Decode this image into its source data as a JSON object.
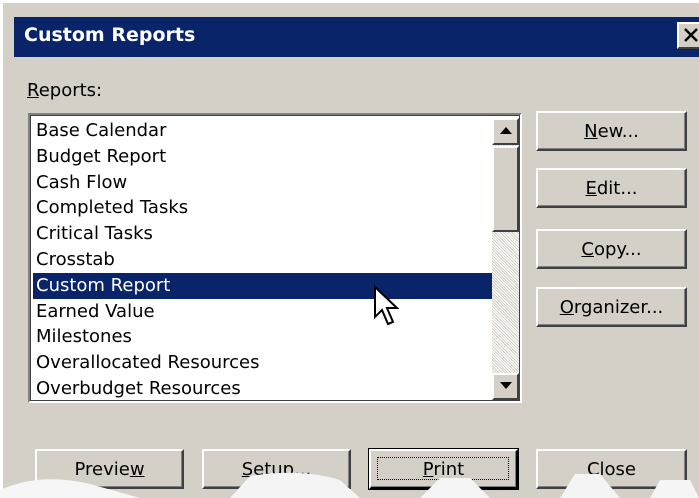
{
  "window": {
    "title": "Custom Reports"
  },
  "reports_label": {
    "prefix": "",
    "accel": "R",
    "rest": "eports:"
  },
  "reports": {
    "items": [
      "Base Calendar",
      "Budget Report",
      "Cash Flow",
      "Completed Tasks",
      "Critical Tasks",
      "Crosstab",
      "Custom Report",
      "Earned Value",
      "Milestones",
      "Overallocated Resources",
      "Overbudget Resources"
    ],
    "selected": "Custom Report"
  },
  "buttons": {
    "new": {
      "prefix": "",
      "accel": "N",
      "rest": "ew..."
    },
    "edit": {
      "prefix": "",
      "accel": "E",
      "rest": "dit..."
    },
    "copy": {
      "prefix": "",
      "accel": "C",
      "rest": "opy..."
    },
    "organizer": {
      "prefix": "",
      "accel": "O",
      "rest": "rganizer..."
    },
    "preview": {
      "prefix": "Previe",
      "accel": "w",
      "rest": ""
    },
    "setup": {
      "prefix": "",
      "accel": "S",
      "rest": "etup..."
    },
    "print": {
      "prefix": "",
      "accel": "P",
      "rest": "rint"
    },
    "close": {
      "prefix": "Close",
      "accel": "",
      "rest": ""
    }
  },
  "icons": {
    "title_close": "close-x-icon",
    "scroll_up": "triangle-up-icon",
    "scroll_down": "triangle-down-icon",
    "pointer": "arrow-pointer-icon"
  },
  "colors": {
    "titlebar": "#0a246a",
    "selection": "#0a246a",
    "face": "#d4d0c8"
  }
}
